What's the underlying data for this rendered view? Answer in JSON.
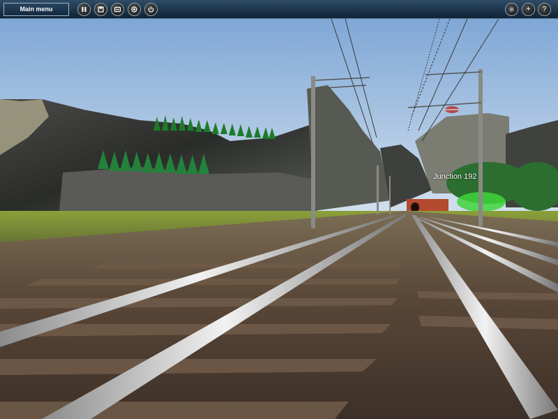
{
  "toolbar": {
    "main_menu_label": "Main menu",
    "left_buttons": [
      {
        "icon": "pause-icon"
      },
      {
        "icon": "save-icon"
      },
      {
        "icon": "driver-view-icon"
      },
      {
        "icon": "camera-icon"
      },
      {
        "icon": "power-icon"
      }
    ],
    "right_buttons": [
      {
        "icon": "circle-icon"
      },
      {
        "icon": "plus-icon",
        "glyph": "+"
      },
      {
        "icon": "help-icon",
        "glyph": "?"
      }
    ]
  },
  "scene": {
    "junction_label": "Junction 192",
    "colors": {
      "sky_top": "#7fa7d6",
      "sky_bottom": "#d5e2ee",
      "grass": "#7d8a3a",
      "ballast": "#5e4a3a",
      "rail": "#d9d9d9",
      "tree": "#1d7a2a"
    }
  }
}
